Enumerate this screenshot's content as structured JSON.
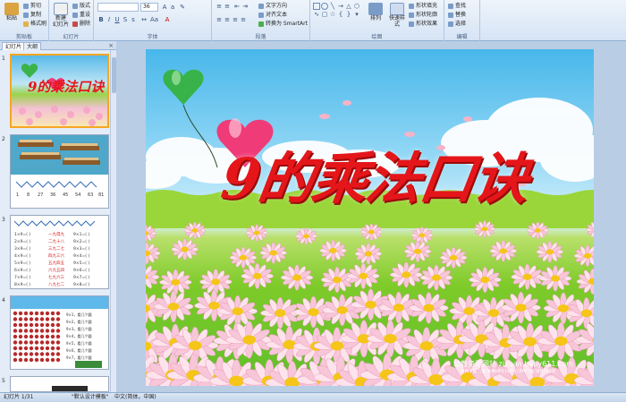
{
  "ribbon": {
    "clipboard": {
      "paste": "粘贴",
      "cut": "剪切",
      "copy": "复制",
      "format_painter": "格式刷",
      "label": "剪贴板"
    },
    "slides": {
      "new_slide": "新建\n幻灯片",
      "layout": "版式",
      "reset": "重设",
      "delete": "删除",
      "label": "幻灯片"
    },
    "font": {
      "font_name": "",
      "font_size": "36",
      "label": "字体"
    },
    "paragraph": {
      "text_direction": "文字方向",
      "align_text": "对齐文本",
      "convert_smartart": "转换为 SmartArt",
      "label": "段落"
    },
    "drawing": {
      "arrange": "排列",
      "quick_styles": "快速样式",
      "shape_fill": "形状填充",
      "shape_outline": "形状轮廓",
      "shape_effects": "形状效果",
      "label": "绘图"
    },
    "editing": {
      "find": "查找",
      "replace": "替换",
      "select": "选择",
      "label": "编辑"
    }
  },
  "leftpane": {
    "tab_slides": "幻灯片",
    "tab_outline": "大纲",
    "close": "×",
    "thumbnails": [
      {
        "num": "1",
        "title": "9的乘法口诀"
      },
      {
        "num": "2"
      },
      {
        "num": "3"
      },
      {
        "num": "4"
      },
      {
        "num": "5"
      }
    ]
  },
  "slide": {
    "title": "9的乘法口诀",
    "watermark": "幼教资源网站 ziyuan.baby611.com",
    "watermark_sub": "课件下载  儿歌  故事MP3  FLASH课件下载  试卷下载等"
  },
  "status": {
    "slide_counter": "幻灯片 1/31",
    "theme": "\"默认设计模板\"",
    "language": "中文(简体，中国)"
  },
  "colors": {
    "title": "#e4161a",
    "accent": "#f5a623",
    "ribbon": "#d6e4f5"
  }
}
